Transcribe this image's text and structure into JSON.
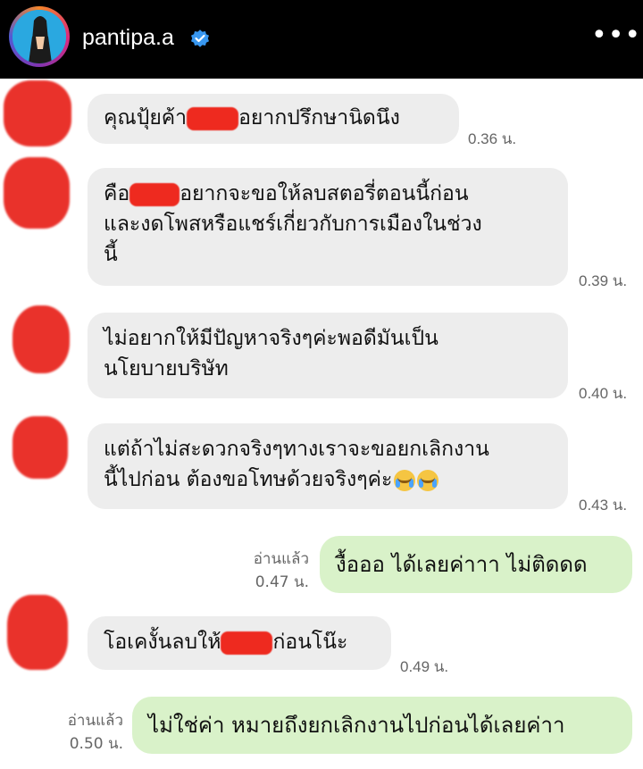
{
  "header": {
    "username": "pantipa.a",
    "verified": true,
    "more_label": "•••"
  },
  "messages": [
    {
      "type": "incoming",
      "text_a": "คุณปุ้ยค้า",
      "text_b": "อยากปรึกษานิดนึง",
      "time": "0.36 น."
    },
    {
      "type": "incoming",
      "line1_a": "คือ",
      "line1_b": "อยากจะขอให้ลบสตอรี่ตอนนี้ก่อน",
      "line2": "และงดโพสหรือแชร์เกี่ยวกับการเมืองในช่วง",
      "line3": "นี้",
      "time": "0.39 น."
    },
    {
      "type": "incoming",
      "line1": "ไม่อยากให้มีปัญหาจริงๆค่ะพอดีมันเป็น",
      "line2": "นโยบายบริษัท",
      "time": "0.40 น."
    },
    {
      "type": "incoming",
      "line1": "แต่ถ้าไม่สะดวกจริงๆทางเราจะขอยกเลิกงาน",
      "line2": "นี้ไปก่อน ต้องขอโทษด้วยจริงๆค่ะ",
      "emoji": "loudly-crying-face",
      "time": "0.43 น."
    },
    {
      "type": "outgoing",
      "text": "งื้อออ ได้เลยค่าาา ไม่ติดดด",
      "read": "อ่านแล้ว",
      "time": "0.47 น."
    },
    {
      "type": "incoming",
      "text_a": "โอเคงั้นลบให้",
      "text_b": "ก่อนโน๊ะ",
      "time": "0.49 น."
    },
    {
      "type": "outgoing",
      "text": "ไม่ใช่ค่า หมายถึงยกเลิกงานไปก่อนได้เลยค่าา",
      "read": "อ่านแล้ว",
      "time": "0.50 น."
    }
  ],
  "colors": {
    "header_bg": "#000000",
    "incoming_bubble": "#ededed",
    "outgoing_bubble": "#d9f2c9",
    "redaction": "#e8231c",
    "verified_badge": "#3897f0"
  }
}
